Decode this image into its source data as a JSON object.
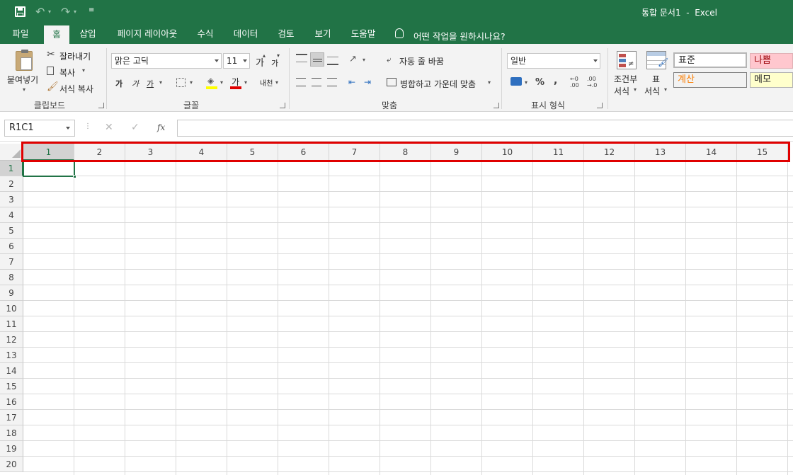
{
  "titlebar": {
    "doc_title": "통합 문서1  -  Excel",
    "quick_access": [
      "save-icon",
      "undo-icon",
      "redo-icon",
      "customize-icon"
    ]
  },
  "tabs": [
    {
      "label": "파일"
    },
    {
      "label": "홈",
      "active": true
    },
    {
      "label": "삽입"
    },
    {
      "label": "페이지 레이아웃"
    },
    {
      "label": "수식"
    },
    {
      "label": "데이터"
    },
    {
      "label": "검토"
    },
    {
      "label": "보기"
    },
    {
      "label": "도움말"
    }
  ],
  "tell_me": "어떤 작업을 원하시나요?",
  "ribbon": {
    "clipboard": {
      "paste": "붙여넣기",
      "cut": "잘라내기",
      "copy": "복사",
      "format_painter": "서식 복사",
      "group": "클립보드"
    },
    "font": {
      "name": "맑은 고딕",
      "size": "11",
      "grow": "가",
      "shrink": "가",
      "bold": "가",
      "italic": "가",
      "underline": "가",
      "font_color_glyph": "가",
      "phonetic": "내천",
      "group": "글꼴"
    },
    "alignment": {
      "wrap_text": "자동 줄 바꿈",
      "merge_center": "병합하고 가운데 맞춤",
      "group": "맞춤"
    },
    "number": {
      "format": "일반",
      "percent": "%",
      "comma": ",",
      "inc_decimal_top": "←0",
      "inc_decimal_bottom": ".00",
      "dec_decimal_top": ".00",
      "dec_decimal_bottom": "→.0",
      "group": "표시 형식"
    },
    "styles": {
      "conditional_line1": "조건부",
      "conditional_line2": "서식",
      "table_line1": "표",
      "table_line2": "서식",
      "normal": "표준",
      "bad": "나쁨",
      "calc": "계산",
      "memo": "메모"
    }
  },
  "formula_bar": {
    "name_box": "R1C1",
    "fx": "fx",
    "value": ""
  },
  "sheet": {
    "columns": [
      "1",
      "2",
      "3",
      "4",
      "5",
      "6",
      "7",
      "8",
      "9",
      "10",
      "11",
      "12",
      "13",
      "14",
      "15"
    ],
    "rows": [
      "1",
      "2",
      "3",
      "4",
      "5",
      "6",
      "7",
      "8",
      "9",
      "10",
      "11",
      "12",
      "13",
      "14",
      "15",
      "16",
      "17",
      "18",
      "19",
      "20"
    ],
    "selected_cell": "R1C1"
  },
  "colors": {
    "brand": "#217346",
    "highlight_box": "#e00000",
    "bad_style_bg": "#ffc7ce",
    "bad_style_text": "#9c0006",
    "calc_style_text": "#fa7d00",
    "memo_style_bg": "#ffffcc"
  }
}
